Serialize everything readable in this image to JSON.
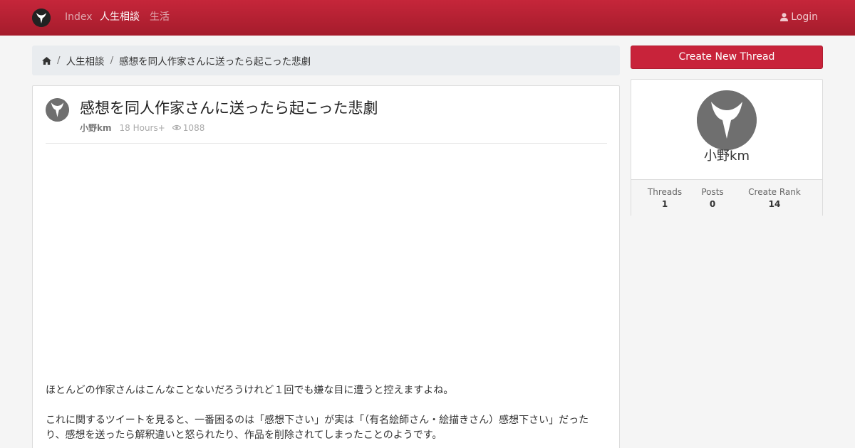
{
  "nav": {
    "links": [
      "Index",
      "人生相談",
      "生活"
    ],
    "active_link": "人生相談",
    "login_label": "Login"
  },
  "breadcrumb": {
    "home_icon": "home-icon",
    "category": "人生相談",
    "current": "感想を同人作家さんに送ったら起こった悲劇"
  },
  "post": {
    "title": "感想を同人作家さんに送ったら起こった悲劇",
    "author": "小野km",
    "time": "18 Hours+",
    "views": "1088",
    "paragraphs": [
      "ほとんどの作家さんはこんなことないだろうけれど１回でも嫌な目に遭うと控えますよね。",
      "これに関するツイートを見ると、一番困るのは「感想下さい」が実は「（有名絵師さん・絵描きさん）感想下さい」だったり、感想を送ったら解釈違いと怒られたり、作品を削除されてしまったことのようです。"
    ]
  },
  "sidebar": {
    "create_button": "Create New Thread",
    "profile": {
      "name": "小野km",
      "stats": [
        {
          "label": "Threads",
          "value": "1"
        },
        {
          "label": "Posts",
          "value": "0"
        },
        {
          "label": "Create Rank",
          "value": "14"
        }
      ]
    }
  },
  "colors": {
    "navbar": "#b8213a",
    "create_button": "#c8233a",
    "breadcrumb_bg": "#e9ecef",
    "page_bg": "#f5f5f5"
  }
}
